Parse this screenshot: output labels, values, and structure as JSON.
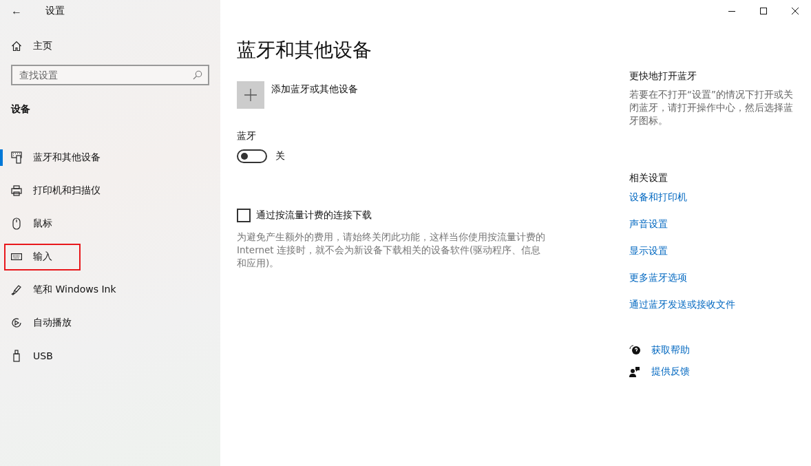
{
  "window": {
    "title": "设置",
    "back": "←"
  },
  "sidebar": {
    "home": "主页",
    "search": {
      "placeholder": "查找设置"
    },
    "section": "设备",
    "items": [
      {
        "label": "蓝牙和其他设备",
        "selected": true,
        "annotated": false
      },
      {
        "label": "打印机和扫描仪",
        "selected": false,
        "annotated": false
      },
      {
        "label": "鼠标",
        "selected": false,
        "annotated": false
      },
      {
        "label": "输入",
        "selected": false,
        "annotated": true
      },
      {
        "label": "笔和 Windows Ink",
        "selected": false,
        "annotated": false
      },
      {
        "label": "自动播放",
        "selected": false,
        "annotated": false
      },
      {
        "label": "USB",
        "selected": false,
        "annotated": false
      }
    ]
  },
  "main": {
    "title": "蓝牙和其他设备",
    "add_device": "添加蓝牙或其他设备",
    "bluetooth": {
      "label": "蓝牙",
      "on": false,
      "state_text": "关"
    },
    "metered": {
      "label": "通过按流量计费的连接下载",
      "checked": false,
      "description": "为避免产生额外的费用，请始终关闭此功能，这样当你使用按流量计费的 Internet 连接时，就不会为新设备下载相关的设备软件(驱动程序、信息和应用)。"
    }
  },
  "aside": {
    "quick_title": "更快地打开蓝牙",
    "quick_text": "若要在不打开“设置”的情况下打开或关闭蓝牙，请打开操作中心，然后选择蓝牙图标。",
    "related_title": "相关设置",
    "links": [
      "设备和打印机",
      "声音设置",
      "显示设置",
      "更多蓝牙选项",
      "通过蓝牙发送或接收文件"
    ],
    "support": [
      {
        "label": "获取帮助"
      },
      {
        "label": "提供反馈"
      }
    ]
  }
}
